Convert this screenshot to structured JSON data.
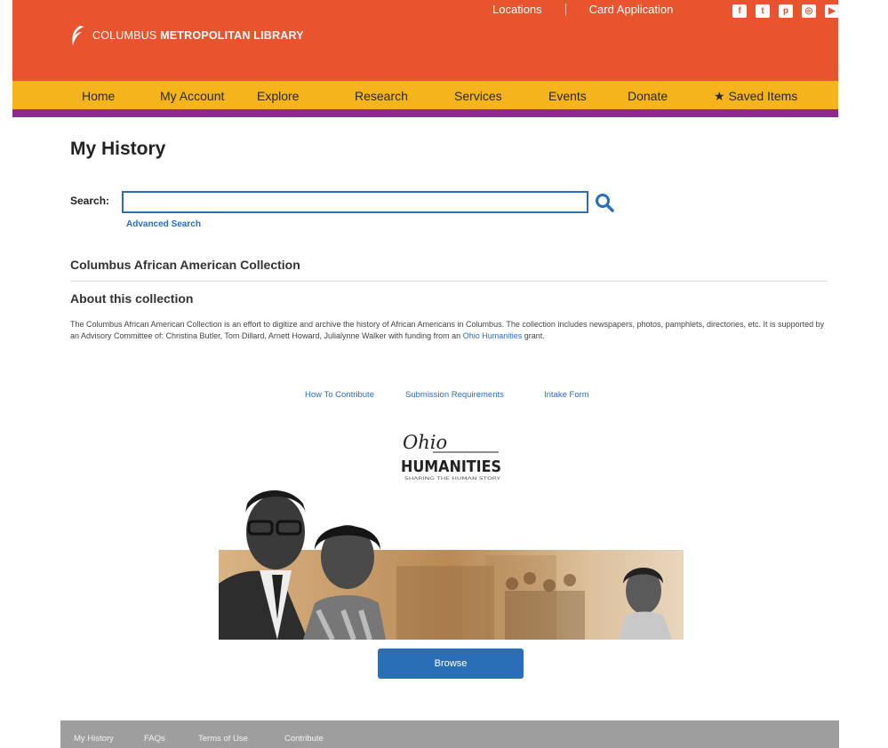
{
  "header": {
    "logo_text_light": "COLUMBUS",
    "logo_text_bold": "METROPOLITAN LIBRARY",
    "top_links": [
      "Locations",
      "Card Application"
    ],
    "social_icons": [
      "facebook-icon",
      "twitter-icon",
      "pinterest-icon",
      "instagram-icon",
      "youtube-icon"
    ],
    "colors": {
      "header_bg": "#e8542e",
      "nav_bg": "#f5b41c",
      "nav_border": "#8e2a8e"
    }
  },
  "nav": {
    "items": [
      "Home",
      "My Account",
      "Explore",
      "Research",
      "Services",
      "Events",
      "Donate",
      "Saved Items"
    ],
    "saved_icon": "star-icon"
  },
  "page": {
    "title": "My History"
  },
  "search": {
    "label": "Search:",
    "value": "",
    "placeholder": "",
    "advanced_label": "Advanced Search"
  },
  "collection": {
    "title": "Columbus African American Collection",
    "about_heading": "About this collection",
    "description_before": "The Columbus African American Collection is an effort to digitize and archive the history of African Americans in Columbus. The collection includes newspapers, photos, pamphlets, directories, etc. It is supported by an Advisory Committee of: Christina Butler, Tom Dillard, Arnett Howard, Julialynne Walker with funding from an ",
    "description_link": "Ohio Humanities",
    "description_after": " grant."
  },
  "sublinks": [
    "How To Contribute",
    "Submission Requirements",
    "Intake Form"
  ],
  "ohio_logo": {
    "script": "Ohio",
    "wordmark": "HUMANITIES",
    "tagline": "SHARING THE HUMAN STORY"
  },
  "browse_label": "Browse",
  "footer": {
    "items": [
      "My History",
      "FAQs",
      "Terms of Use",
      "Contribute"
    ]
  }
}
